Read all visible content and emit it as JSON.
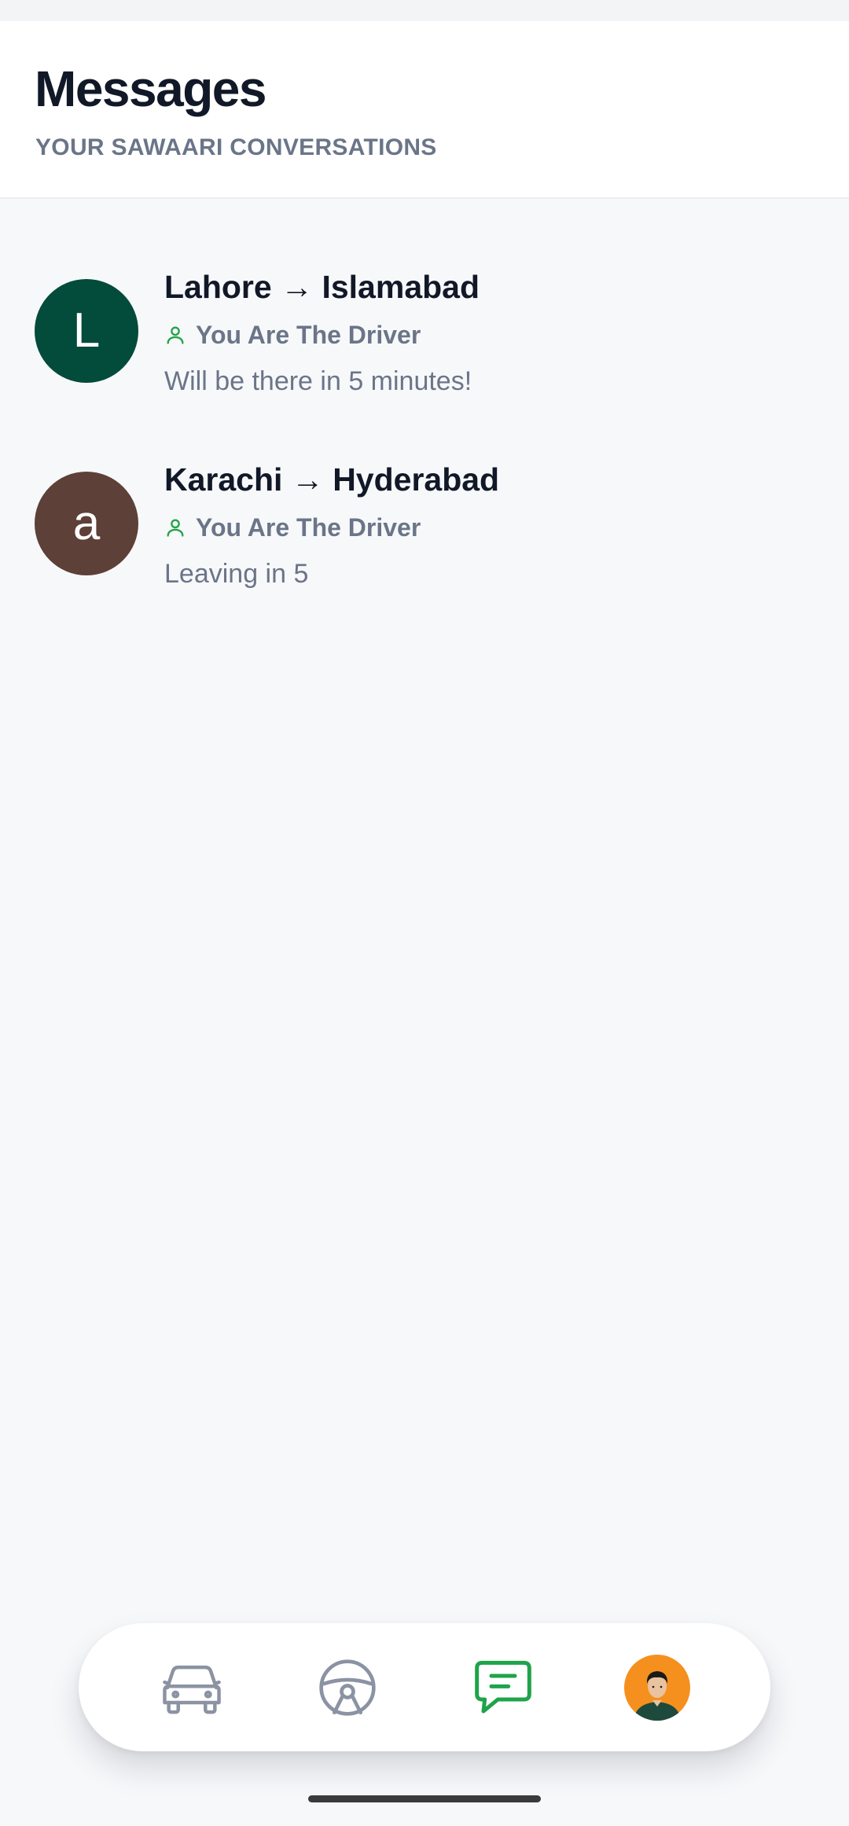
{
  "header": {
    "title": "Messages",
    "subtitle": "YOUR SAWAARI CONVERSATIONS"
  },
  "conversations": [
    {
      "avatar_letter": "L",
      "avatar_color": "#034b3a",
      "route": "Lahore → Islamabad",
      "role": "You Are The Driver",
      "last_message": "Will be there in 5 minutes!"
    },
    {
      "avatar_letter": "a",
      "avatar_color": "#5d4037",
      "route": "Karachi → Hyderabad",
      "role": "You Are The Driver",
      "last_message": "Leaving in 5"
    }
  ],
  "tabbar": {
    "tabs": [
      {
        "icon": "car-icon",
        "active": false
      },
      {
        "icon": "steering-wheel-icon",
        "active": false
      },
      {
        "icon": "chat-bubble-icon",
        "active": true
      },
      {
        "icon": "profile-avatar",
        "active": false
      }
    ],
    "active_color": "#1fa34a",
    "inactive_color": "#8b93a3"
  },
  "colors": {
    "role_icon": "#22a447",
    "profile_bg": "#f5901e"
  }
}
